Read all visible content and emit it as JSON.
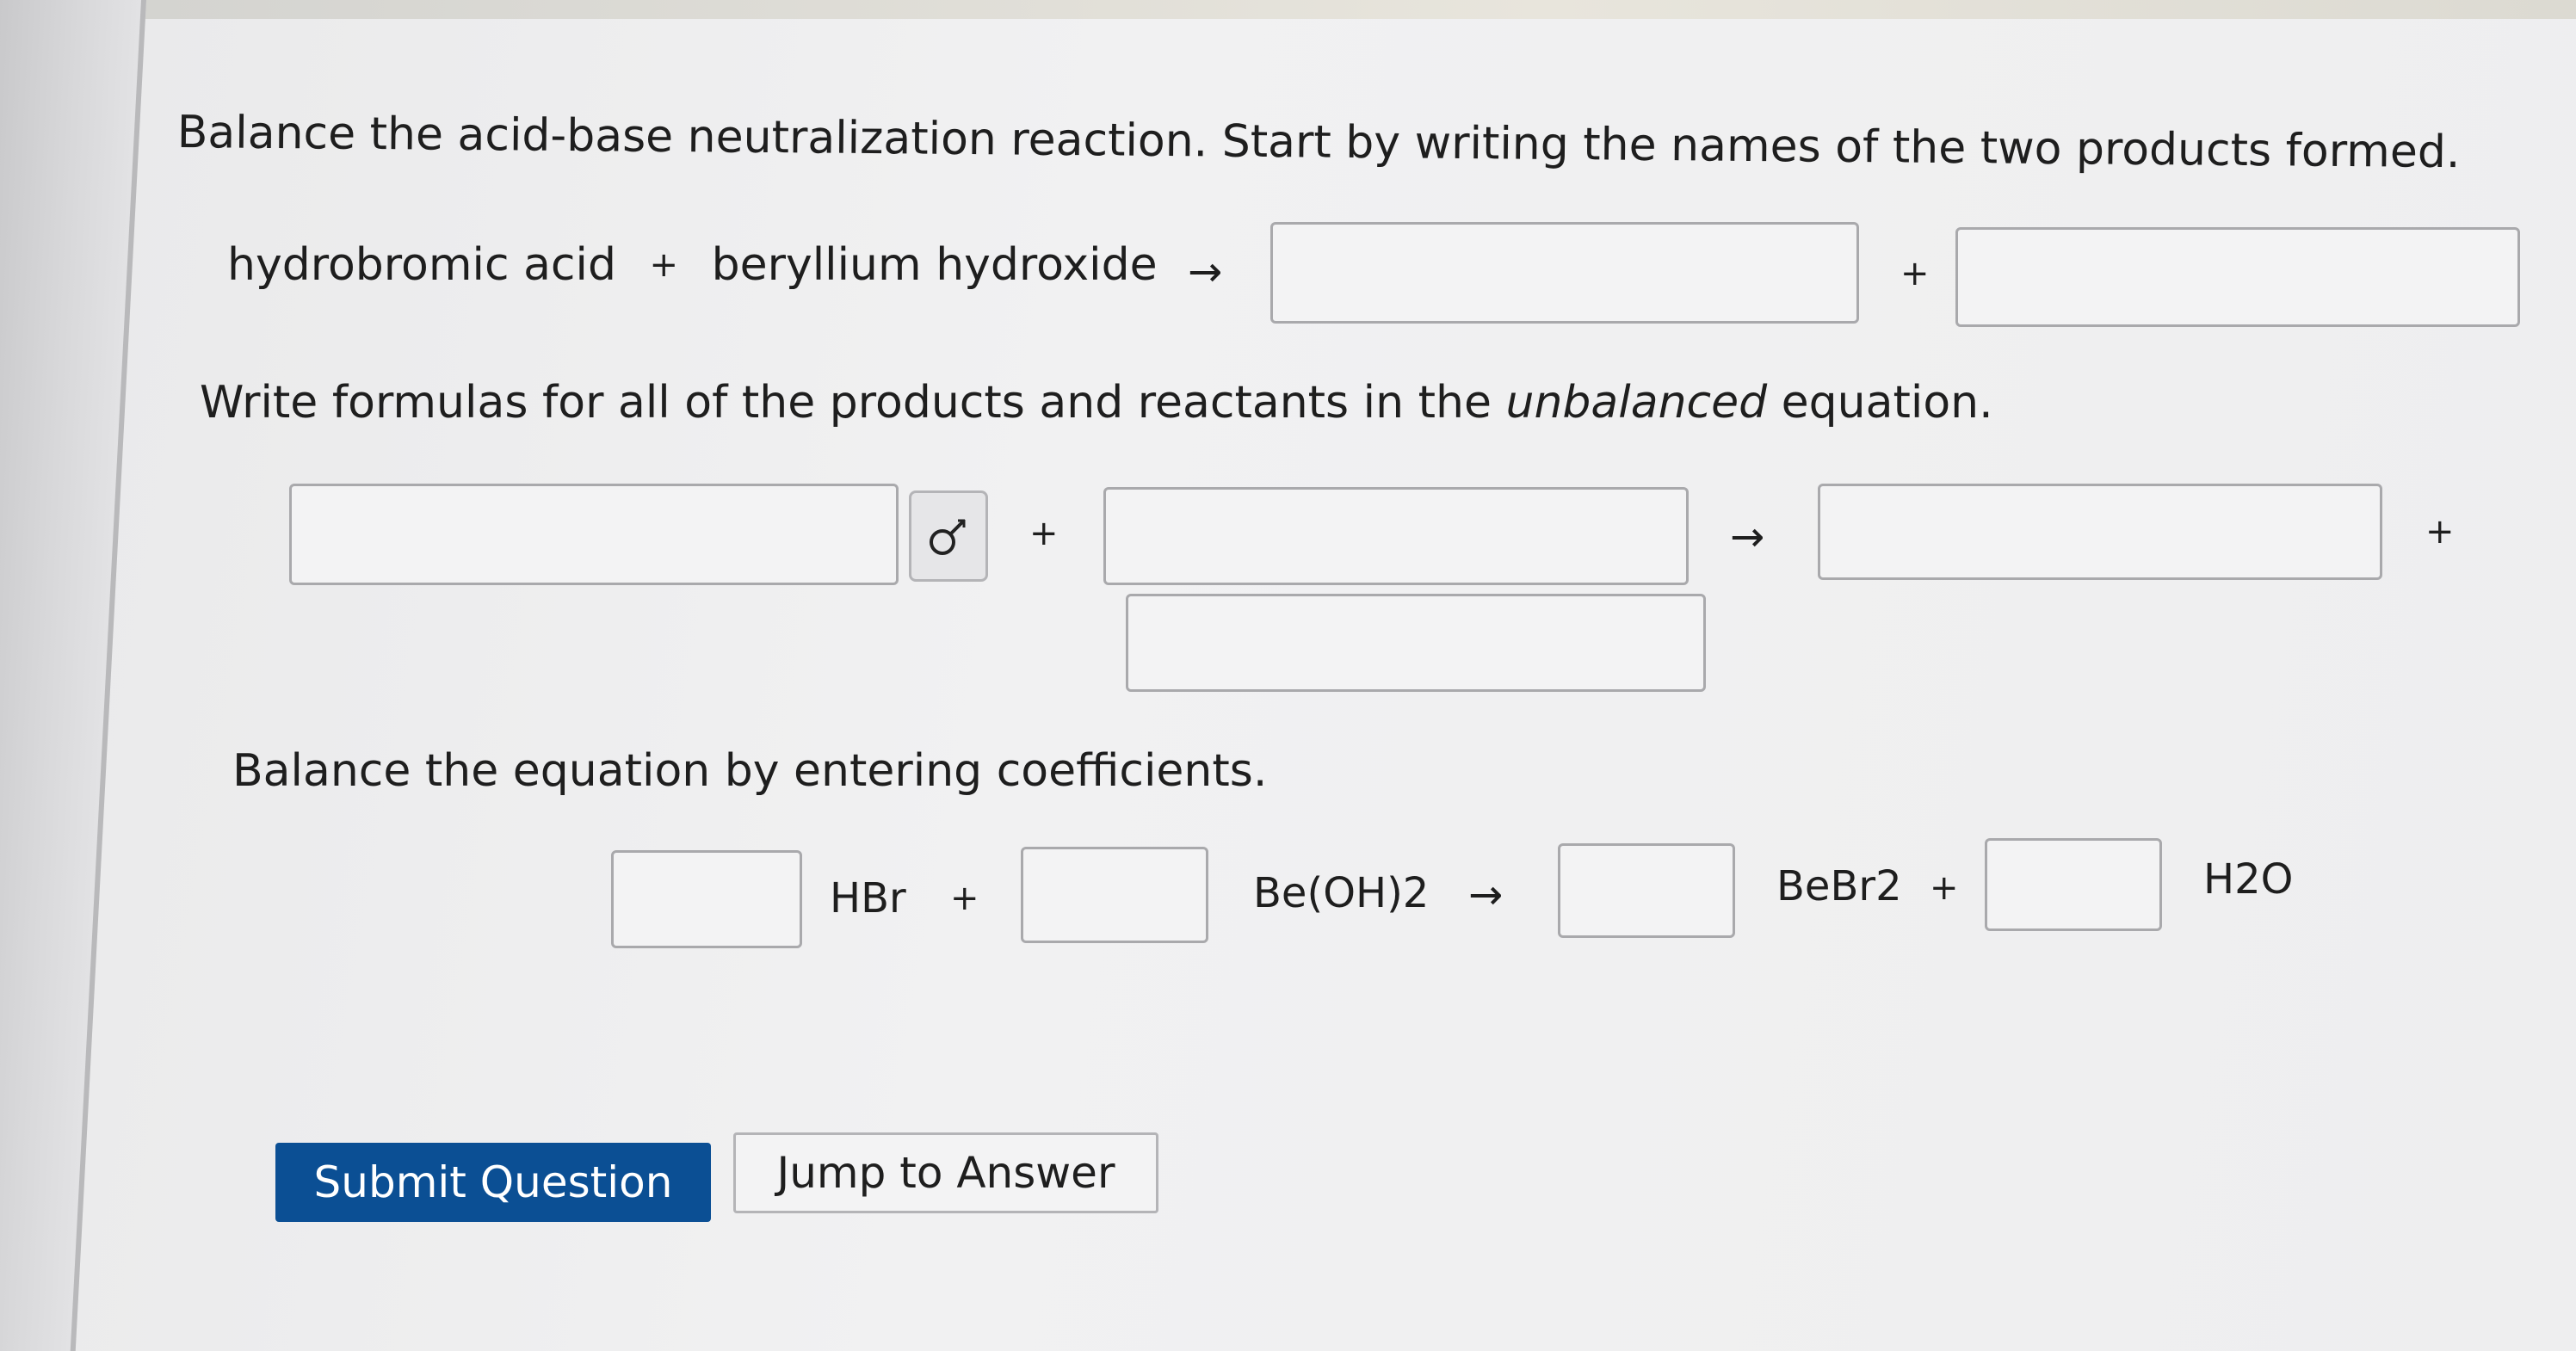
{
  "question": {
    "names_prompt": "Balance the acid-base neutralization reaction.  Start by writing the names of the two products formed.",
    "reactant_1_name": "hydrobromic acid",
    "reactant_2_name": "beryllium hydroxide",
    "plus": "+",
    "arrow": "→",
    "formula_prompt_before": "Write formulas for all of the products and reactants in the ",
    "formula_prompt_emph": "unbalanced",
    "formula_prompt_after": " equation.",
    "coefficient_prompt": "Balance the equation by entering coefficients."
  },
  "name_inputs": {
    "product_1": "",
    "product_2": ""
  },
  "formula_inputs": {
    "reactant_1": "",
    "reactant_2": "",
    "product_1": "",
    "product_2": ""
  },
  "balance": {
    "species": [
      "HBr",
      "Be(OH)2",
      "BeBr2",
      "H2O"
    ],
    "coefficients": [
      "",
      "",
      "",
      ""
    ]
  },
  "icons": {
    "symbol_button": "subscript-superscript-icon"
  },
  "buttons": {
    "submit_label": "Submit Question",
    "jump_label": "Jump to Answer"
  },
  "colors": {
    "submit_bg": "#0b4f94",
    "text": "#1e1e1e"
  }
}
